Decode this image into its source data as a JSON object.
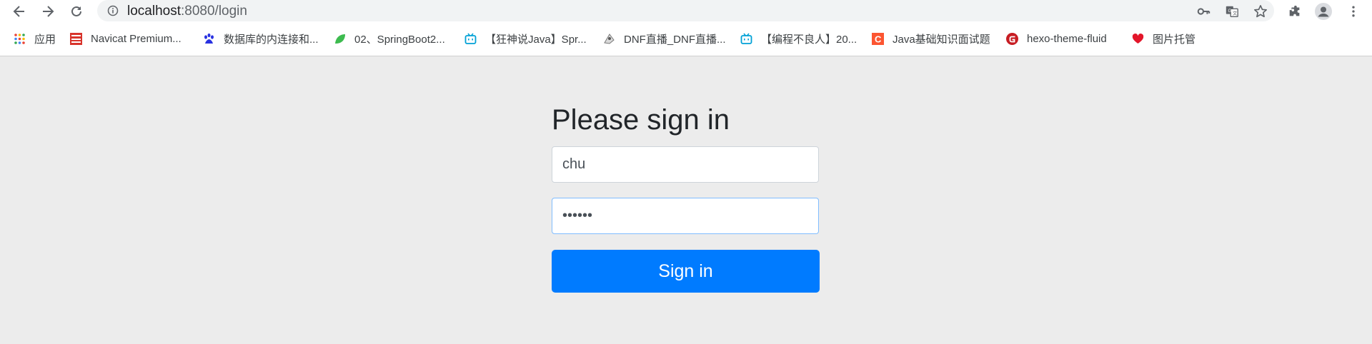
{
  "browser": {
    "url_host": "localhost",
    "url_rest": ":8080/login"
  },
  "bookmarks": [
    {
      "label": "应用",
      "icon": "apps-grid-icon"
    },
    {
      "label": "Navicat Premium...",
      "icon": "navicat-icon"
    },
    {
      "label": "数据库的内连接和...",
      "icon": "baidu-paw-icon"
    },
    {
      "label": "02、SpringBoot2...",
      "icon": "leaf-icon"
    },
    {
      "label": "【狂神说Java】Spr...",
      "icon": "bilibili-icon"
    },
    {
      "label": "DNF直播_DNF直播...",
      "icon": "dnf-icon"
    },
    {
      "label": "【编程不良人】20...",
      "icon": "bilibili-icon"
    },
    {
      "label": "Java基础知识面试题",
      "icon": "csdn-icon"
    },
    {
      "label": "hexo-theme-fluid",
      "icon": "gitee-icon"
    },
    {
      "label": "图片托管",
      "icon": "heart-icon"
    }
  ],
  "form": {
    "heading": "Please sign in",
    "username": "chu",
    "password_mask": "••••••",
    "submit_label": "Sign in"
  }
}
